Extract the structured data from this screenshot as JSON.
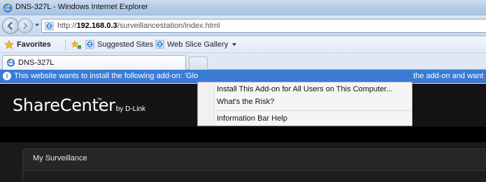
{
  "window": {
    "title": "DNS-327L - Windows Internet Explorer"
  },
  "address_bar": {
    "url_prefix": "http://",
    "url_host": "192.168.0.3",
    "url_path": "/surveillancestation/index.html"
  },
  "favorites_bar": {
    "favorites_label": "Favorites",
    "items": [
      {
        "label": "Suggested Sites",
        "icon": "ie-page-icon"
      },
      {
        "label": "Web Slice Gallery",
        "icon": "ie-page-icon"
      }
    ]
  },
  "tabs": [
    {
      "label": "DNS-327L"
    }
  ],
  "info_bar": {
    "text": "This website wants to install the following add-on: 'Glo",
    "text_tail": "the add-on and want t"
  },
  "context_menu": {
    "items": [
      {
        "label": "Install This Add-on for All Users on This Computer..."
      },
      {
        "label": "What's the Risk?"
      },
      {
        "label": "Information Bar Help"
      }
    ]
  },
  "page": {
    "logo_brand": "ShareCenter",
    "logo_tm": "™",
    "logo_by": "by D-Link",
    "panel_title": "My Surveillance"
  },
  "colors": {
    "infobar": "#3a7bd5",
    "page_bg": "#1a1a1a",
    "menu_bg": "#f5f5f5"
  }
}
